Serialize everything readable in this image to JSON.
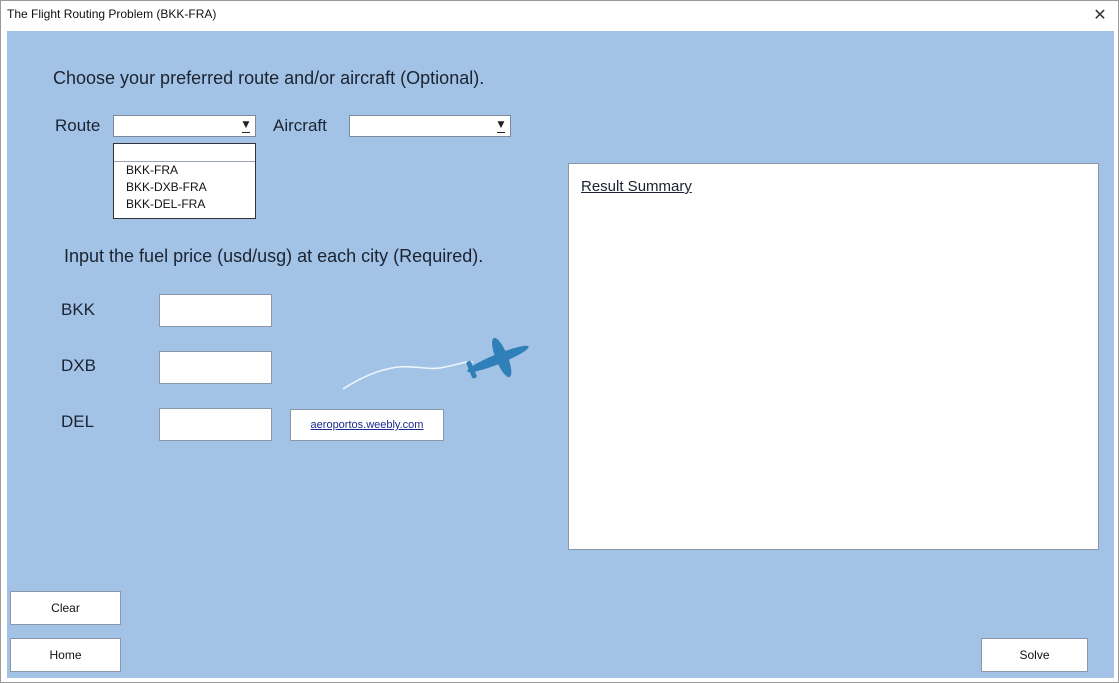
{
  "window": {
    "title": "The Flight Routing Problem (BKK-FRA)",
    "close_glyph": "✕"
  },
  "form": {
    "instruction": "Choose your preferred route and/or aircraft (Optional).",
    "route_label": "Route",
    "route_value": "",
    "aircraft_label": "Aircraft",
    "aircraft_value": "",
    "route_options": [
      "BKK-FRA",
      "BKK-DXB-FRA",
      "BKK-DEL-FRA"
    ],
    "fuel_instruction": "Input the fuel price (usd/usg) at each city (Required).",
    "cities": [
      {
        "label": "BKK",
        "value": ""
      },
      {
        "label": "DXB",
        "value": ""
      },
      {
        "label": "DEL",
        "value": ""
      }
    ],
    "link_text": "aeroportos.weebly.com"
  },
  "result": {
    "title": "Result Summary"
  },
  "buttons": {
    "clear": "Clear",
    "home": "Home",
    "solve": "Solve"
  },
  "colors": {
    "client_bg": "#a3c3e6",
    "plane": "#2f7fb8",
    "link": "#1b2a8c"
  },
  "icons": {
    "plane": "airplane-icon",
    "dropdown_arrow": "chevron-down-icon",
    "close": "close-icon"
  }
}
